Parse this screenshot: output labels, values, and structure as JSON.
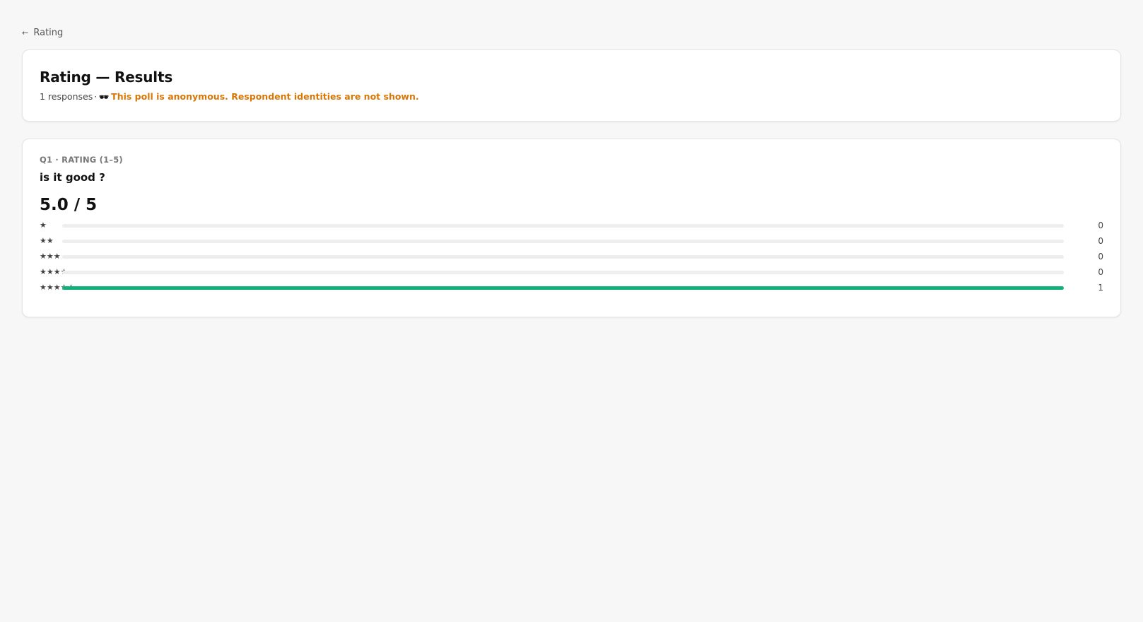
{
  "nav": {
    "back_arrow": "←",
    "back_label": "Rating"
  },
  "header": {
    "title": "Rating — Results",
    "responses": "1 responses",
    "separator": "·",
    "anon_icon": "sunglasses-icon",
    "anon_glyph": "🕶",
    "anon_text": "This poll is anonymous. Respondent identities are not shown."
  },
  "question": {
    "meta": "Q1 · RATING (1–5)",
    "title": "is it good ?",
    "average": "5.0 / 5",
    "accent_color": "#10b27a",
    "rows": [
      {
        "stars": "★",
        "count": "0",
        "fraction": 0
      },
      {
        "stars": "★★",
        "count": "0",
        "fraction": 0
      },
      {
        "stars": "★★★",
        "count": "0",
        "fraction": 0
      },
      {
        "stars": "★★★★",
        "count": "0",
        "fraction": 0
      },
      {
        "stars": "★★★★★",
        "count": "1",
        "fraction": 1
      }
    ]
  }
}
